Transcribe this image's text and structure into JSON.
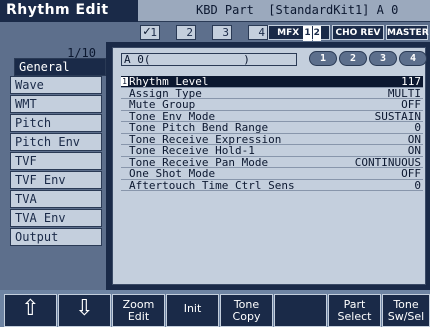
{
  "title": {
    "screen": "Rhythm Edit",
    "part_info": "KBD Part  [StandardKit1] A 0"
  },
  "status": {
    "parts": [
      {
        "num": "1",
        "checked": true
      },
      {
        "num": "2",
        "checked": false
      },
      {
        "num": "3",
        "checked": false
      },
      {
        "num": "4",
        "checked": false
      }
    ],
    "mfx": "MFX",
    "mfx_nums": [
      "1",
      "2"
    ],
    "cho_rev": "CHO REV",
    "master": "MASTER"
  },
  "sidebar": {
    "page_count": "1/10",
    "items": [
      {
        "label": "General",
        "active": true
      },
      {
        "label": "Wave"
      },
      {
        "label": "WMT"
      },
      {
        "label": "Pitch"
      },
      {
        "label": "Pitch Env"
      },
      {
        "label": "TVF"
      },
      {
        "label": "TVF Env"
      },
      {
        "label": "TVA"
      },
      {
        "label": "TVA Env"
      },
      {
        "label": "Output"
      }
    ]
  },
  "main": {
    "tone_field": "A 0(              )",
    "tone_buttons": [
      "1",
      "2",
      "3",
      "4"
    ],
    "params": [
      {
        "idx": "1",
        "name": "Rhythm Level",
        "value": "117",
        "selected": true
      },
      {
        "name": "Assign Type",
        "value": "MULTI"
      },
      {
        "name": "Mute Group",
        "value": "OFF"
      },
      {
        "name": "Tone Env Mode",
        "value": "SUSTAIN"
      },
      {
        "name": "Tone Pitch Bend Range",
        "value": "0"
      },
      {
        "name": "Tone Receive Expression",
        "value": "ON"
      },
      {
        "name": "Tone Receive Hold-1",
        "value": "ON"
      },
      {
        "name": "Tone Receive Pan Mode",
        "value": "CONTINUOUS"
      },
      {
        "name": "One Shot Mode",
        "value": "OFF"
      },
      {
        "name": "Aftertouch Time Ctrl Sens",
        "value": "0"
      }
    ]
  },
  "functions": {
    "up_arrow": "⇧",
    "down_arrow": "⇩",
    "zoom_edit": [
      "Zoom",
      "Edit"
    ],
    "init": "Init",
    "tone_copy": [
      "Tone",
      "Copy"
    ],
    "blank": "",
    "part_select": [
      "Part",
      "Select"
    ],
    "tone_sw_sel": [
      "Tone",
      "Sw/Sel"
    ]
  }
}
